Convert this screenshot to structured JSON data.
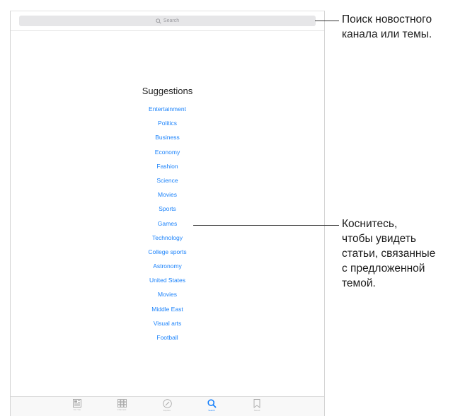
{
  "search": {
    "placeholder": "Search"
  },
  "suggestions": {
    "title": "Suggestions",
    "items": [
      "Entertainment",
      "Politics",
      "Business",
      "Economy",
      "Fashion",
      "Science",
      "Movies",
      "Sports",
      "Games",
      "Technology",
      "College sports",
      "Astronomy",
      "United States",
      "Movies",
      "Middle East",
      "Visual arts",
      "Football"
    ]
  },
  "tabbar": {
    "tabs": [
      {
        "icon": "for-you-icon",
        "label": "For You"
      },
      {
        "icon": "channels-icon",
        "label": "Channels"
      },
      {
        "icon": "explore-icon",
        "label": "Explore"
      },
      {
        "icon": "search-icon",
        "label": "Search"
      },
      {
        "icon": "saved-icon",
        "label": "Saved"
      }
    ]
  },
  "callouts": {
    "search_line1": "Поиск новостного",
    "search_line2": "канала или темы.",
    "tap_line1": "Коснитесь,",
    "tap_line2": "чтобы увидеть",
    "tap_line3": "статьи, связанные",
    "tap_line4": "с предложенной",
    "tap_line5": "темой."
  },
  "colors": {
    "accent": "#1a82fb",
    "search_bg": "#e6e6e8"
  }
}
